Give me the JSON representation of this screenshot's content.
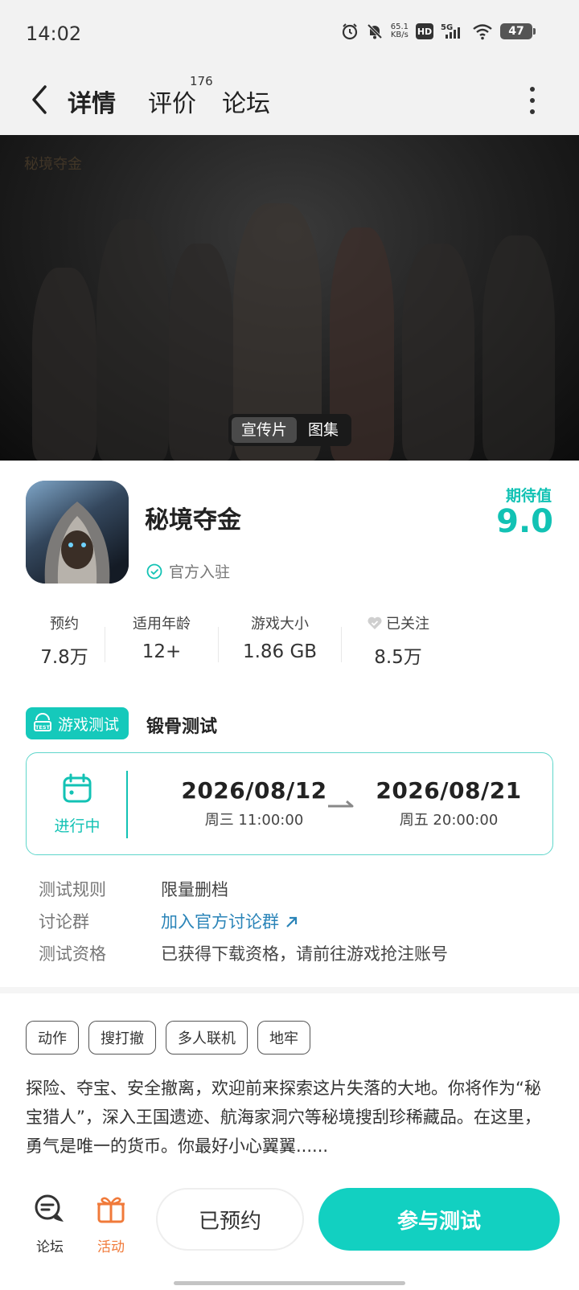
{
  "status_bar": {
    "time": "14:02",
    "net_speed_value": "65.1",
    "net_speed_unit": "KB/s",
    "hd_label": "HD",
    "network_label": "5G",
    "battery": "47",
    "icons": [
      "alarm-icon",
      "mute-icon",
      "signal-icon",
      "wifi-icon",
      "battery-icon"
    ]
  },
  "header": {
    "tabs": [
      {
        "label": "详情",
        "active": true
      },
      {
        "label": "评价",
        "count": "176"
      },
      {
        "label": "论坛"
      }
    ]
  },
  "banner": {
    "logo_text": "秘境夺金",
    "media_tabs": [
      {
        "label": "宣传片",
        "active": true
      },
      {
        "label": "图集"
      }
    ]
  },
  "app": {
    "name": "秘境夺金",
    "official_label": "官方入驻",
    "expect_label": "期待值",
    "expect_value": "9.0"
  },
  "stats": [
    {
      "label": "预约",
      "value": "7.8万"
    },
    {
      "label": "适用年龄",
      "value": "12+"
    },
    {
      "label": "游戏大小",
      "value": "1.86 GB"
    },
    {
      "label": "已关注",
      "value": "8.5万"
    }
  ],
  "test": {
    "tag_label": "游戏测试",
    "name": "锻骨测试",
    "status": "进行中",
    "start_date": "2026/08/12",
    "start_time": "周三  11:00:00",
    "end_date": "2026/08/21",
    "end_time": "周五  20:00:00",
    "rules": [
      {
        "key": "测试规则",
        "value": "限量删档"
      },
      {
        "key": "讨论群",
        "value": "加入官方讨论群"
      },
      {
        "key": "测试资格",
        "value": "已获得下载资格，请前往游戏抢注账号"
      }
    ]
  },
  "tags": [
    "动作",
    "搜打撤",
    "多人联机",
    "地牢"
  ],
  "description": "探险、夺宝、安全撤离，欢迎前来探索这片失落的大地。你将作为“秘宝猎人”，深入王国遗迹、航海家洞穴等秘境搜刮珍稀藏品。在这里，勇气是唯一的货币。你最好小心翼翼......",
  "bottom_bar": {
    "forum_label": "论坛",
    "activity_label": "活动",
    "reserved_label": "已预约",
    "join_label": "参与测试"
  },
  "colors": {
    "accent": "#12d0c1",
    "link": "#2a84b8",
    "activity": "#f07a3a"
  }
}
